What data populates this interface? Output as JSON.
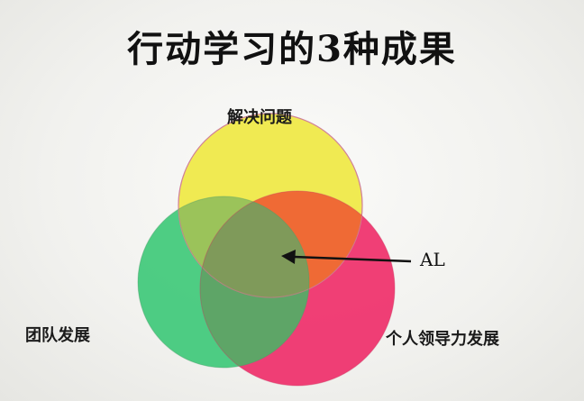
{
  "title": "行动学习的3种成果",
  "circles": {
    "top": {
      "label": "解决问题",
      "color": "#f0ea4a"
    },
    "left": {
      "label": "团队发展",
      "color": "#3fc97a"
    },
    "right": {
      "label": "个人领导力发展",
      "color": "#ef2f6a"
    }
  },
  "center_label": "AL",
  "overlap_colors": {
    "top_right": "#ef6a35",
    "top_left": "#9bc35a",
    "all_three": "#7f9a5a"
  }
}
